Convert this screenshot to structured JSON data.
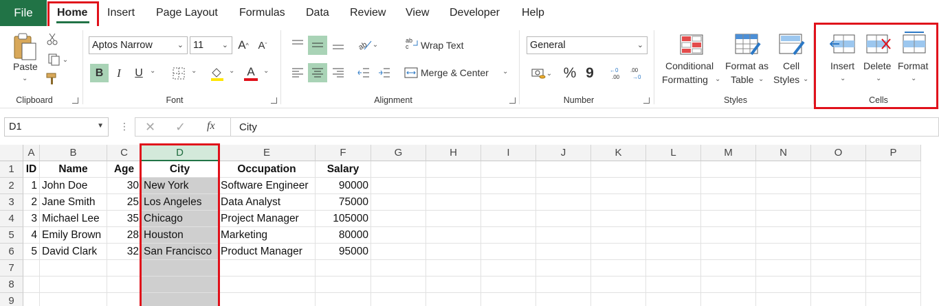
{
  "tabs": [
    "File",
    "Home",
    "Insert",
    "Page Layout",
    "Formulas",
    "Data",
    "Review",
    "View",
    "Developer",
    "Help"
  ],
  "ribbon": {
    "clipboard": {
      "paste_label": "Paste",
      "group_label": "Clipboard"
    },
    "font": {
      "font_name": "Aptos Narrow",
      "font_size": "11",
      "bold": "B",
      "italic": "I",
      "underline": "U",
      "font_color_glyph": "A",
      "grow": "A^",
      "shrink": "Aˇ",
      "group_label": "Font"
    },
    "alignment": {
      "wrap_text": "Wrap Text",
      "merge_center": "Merge & Center",
      "group_label": "Alignment"
    },
    "number": {
      "format": "General",
      "percent": "%",
      "comma": "9",
      "group_label": "Number"
    },
    "styles": {
      "conditional_1": "Conditional",
      "conditional_2": "Formatting",
      "format_table_1": "Format as",
      "format_table_2": "Table",
      "cell_styles_1": "Cell",
      "cell_styles_2": "Styles",
      "group_label": "Styles"
    },
    "cells": {
      "insert": "Insert",
      "delete": "Delete",
      "format": "Format",
      "group_label": "Cells"
    }
  },
  "formula_bar": {
    "name_box": "D1",
    "fx": "fx",
    "content": "City"
  },
  "columns": [
    "A",
    "B",
    "C",
    "D",
    "E",
    "F",
    "G",
    "H",
    "I",
    "J",
    "K",
    "L",
    "M",
    "N",
    "O",
    "P"
  ],
  "rows": [
    "1",
    "2",
    "3",
    "4",
    "5",
    "6",
    "7",
    "8",
    "9"
  ],
  "table": {
    "headers": [
      "ID",
      "Name",
      "Age",
      "City",
      "Occupation",
      "Salary"
    ],
    "data": [
      [
        "1",
        "John Doe",
        "30",
        "New York",
        "Software Engineer",
        "90000"
      ],
      [
        "2",
        "Jane Smith",
        "25",
        "Los Angeles",
        "Data Analyst",
        "75000"
      ],
      [
        "3",
        "Michael Lee",
        "35",
        "Chicago",
        "Project Manager",
        "105000"
      ],
      [
        "4",
        "Emily Brown",
        "28",
        "Houston",
        "Marketing",
        "80000"
      ],
      [
        "5",
        "David Clark",
        "32",
        "San Francisco",
        "Product Manager",
        "95000"
      ]
    ]
  },
  "colors": {
    "accent": "#217346",
    "highlight": "#e0101a",
    "selection": "#cfcfcf"
  }
}
